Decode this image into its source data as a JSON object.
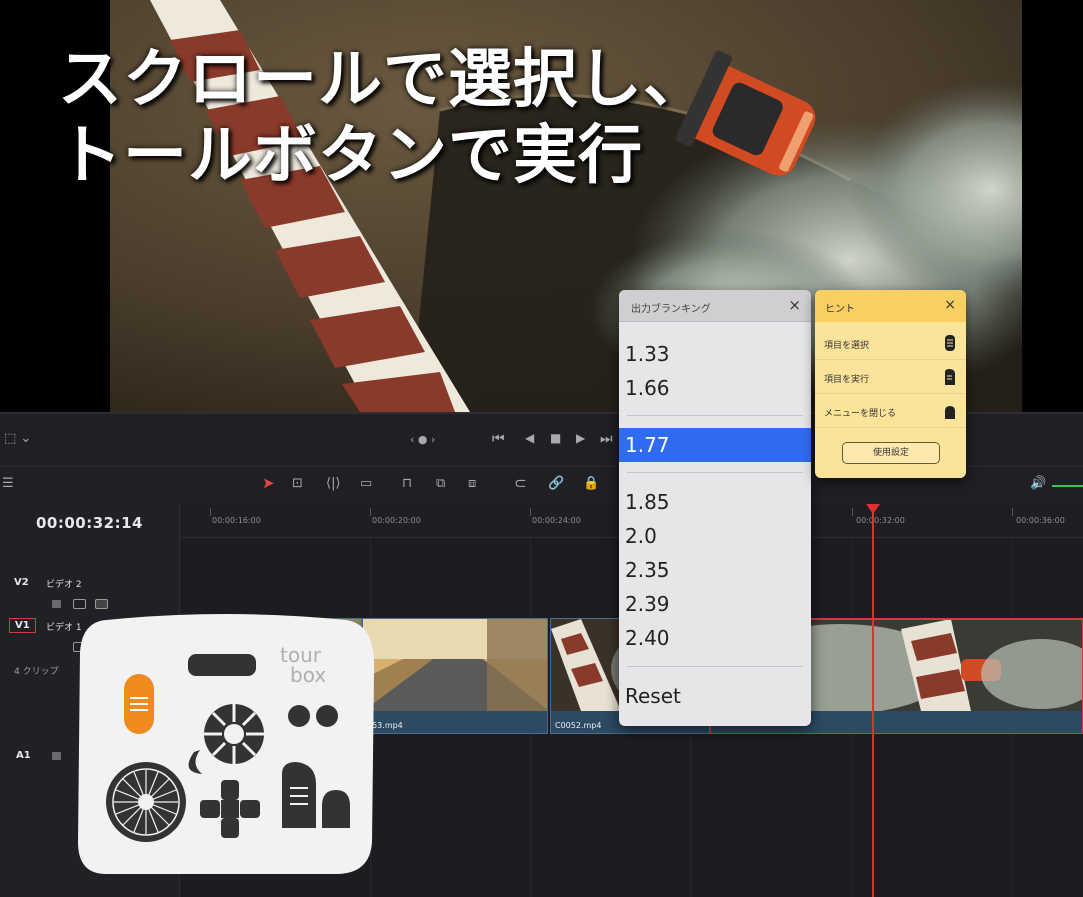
{
  "caption": {
    "line1": "スクロールで選択し、",
    "line2": "トールボタンで実行"
  },
  "transport": {
    "prev_label": "‹ ● ›"
  },
  "timeline": {
    "timecode": "00:00:32:14",
    "ruler_labels": [
      "00:00:16:00",
      "00:00:20:00",
      "00:00:24:00",
      "00:00:32:00",
      "00:00:36:00"
    ],
    "tracks": {
      "v2": {
        "id": "V2",
        "name": "ビデオ 2"
      },
      "v1": {
        "id": "V1",
        "name": "ビデオ 1",
        "clips_label": "4 クリップ"
      },
      "a1": {
        "id": "A1"
      }
    },
    "clips": [
      {
        "name": "053.mp4"
      },
      {
        "name": "C0052.mp4"
      }
    ]
  },
  "blanking_popup": {
    "title": "出力ブランキング",
    "close": "×",
    "options": [
      "1.33",
      "1.66",
      "1.77",
      "1.85",
      "2.0",
      "2.35",
      "2.39",
      "2.40"
    ],
    "selected": "1.77",
    "reset": "Reset"
  },
  "hint_panel": {
    "title": "ヒント",
    "close": "×",
    "rows": [
      {
        "label": "項目を選択",
        "icon": "scroll-wheel-icon"
      },
      {
        "label": "項目を実行",
        "icon": "tall-button-icon"
      },
      {
        "label": "メニューを閉じる",
        "icon": "short-button-icon"
      }
    ],
    "settings_button": "使用設定"
  },
  "tourbox": {
    "logo_line1": "tour",
    "logo_line2": "box"
  },
  "colors": {
    "accent_selected": "#2f6cf0",
    "hint_bg": "#fbe39a",
    "playhead": "#e03030",
    "tourbox_orange": "#f08a1c"
  }
}
